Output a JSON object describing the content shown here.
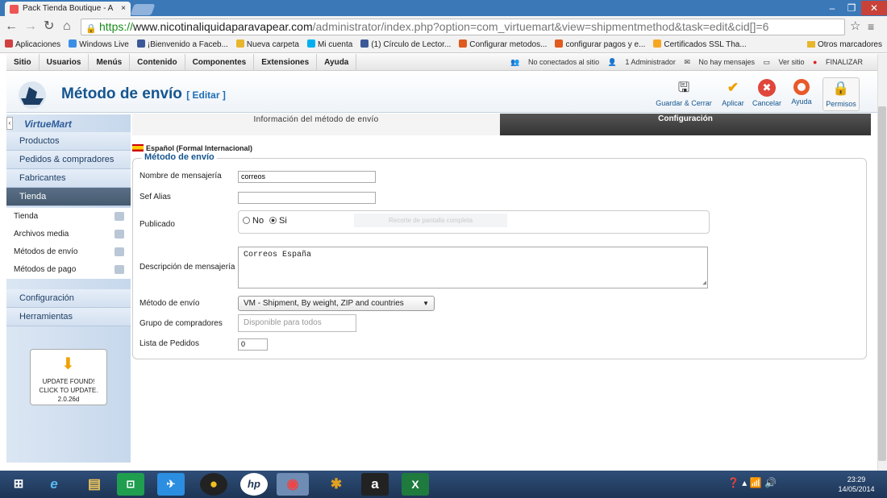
{
  "browser": {
    "tab_title": "Pack Tienda Boutique - A",
    "tab_close": "×",
    "url_scheme": "https://",
    "url_host": "www.nicotinaliquidaparavapear.com",
    "url_path": "/administrator/index.php?option=com_virtuemart&view=shipmentmethod&task=edit&cid[]=6",
    "bookmarks": [
      {
        "label": "Aplicaciones",
        "color": "#d04040"
      },
      {
        "label": "Windows Live",
        "color": "#3a8ee6"
      },
      {
        "label": "¡Bienvenido a Faceb...",
        "color": "#3b5998"
      },
      {
        "label": "Nueva carpeta",
        "color": "#e8b62c"
      },
      {
        "label": "Mi cuenta",
        "color": "#00aff0"
      },
      {
        "label": "(1) Círculo de Lector...",
        "color": "#3b5998"
      },
      {
        "label": "Configurar metodos...",
        "color": "#e05a1e"
      },
      {
        "label": "configurar pagos y e...",
        "color": "#e05a1e"
      },
      {
        "label": "Certificados SSL Tha...",
        "color": "#f5a623"
      }
    ],
    "other_bookmarks": "Otros marcadores"
  },
  "admin_menu": [
    "Sitio",
    "Usuarios",
    "Menús",
    "Contenido",
    "Componentes",
    "Extensiones",
    "Ayuda"
  ],
  "status": {
    "visitors": "No conectados al sitio",
    "admins": "1 Administrador",
    "messages": "No hay mensajes",
    "view_site": "Ver sitio",
    "logout": "FINALIZAR"
  },
  "header": {
    "title": "Método de envío",
    "subtitle": "[ Editar ]"
  },
  "toolbar": {
    "save_close": "Guardar & Cerrar",
    "apply": "Aplicar",
    "cancel": "Cancelar",
    "help": "Ayuda",
    "permissions": "Permisos"
  },
  "sidebar": {
    "brand": "VirtueMart",
    "sections": [
      "Productos",
      "Pedidos & compradores",
      "Fabricantes",
      "Tienda"
    ],
    "sub_items": [
      "Tienda",
      "Archivos media",
      "Métodos de envío",
      "Métodos de pago"
    ],
    "bottom_sections": [
      "Configuración",
      "Herramientas"
    ],
    "update_text": [
      "UPDATE FOUND!",
      "CLICK TO UPDATE.",
      "2.0.26d"
    ]
  },
  "tabs": {
    "info": "Información del método de envío",
    "config": "Configuración"
  },
  "form": {
    "language": "Español (Formal Internacional)",
    "legend": "Método de envío",
    "name_label": "Nombre de mensajería",
    "name_value": "correos",
    "alias_label": "Sef Alias",
    "alias_value": "",
    "published_label": "Publicado",
    "no": "No",
    "yes": "Si",
    "ghost_text": "Recorte de pantalla completa",
    "desc_label": "Descripción de mensajería",
    "desc_value": "Correos España",
    "method_label": "Método de envío",
    "method_value": "VM - Shipment, By weight, ZIP and countries",
    "group_label": "Grupo de compradores",
    "group_placeholder": "Disponible para todos",
    "order_label": "Lista de Pedidos",
    "order_value": "0"
  },
  "taskbar": {
    "time": "23:29",
    "date": "14/05/2014"
  }
}
